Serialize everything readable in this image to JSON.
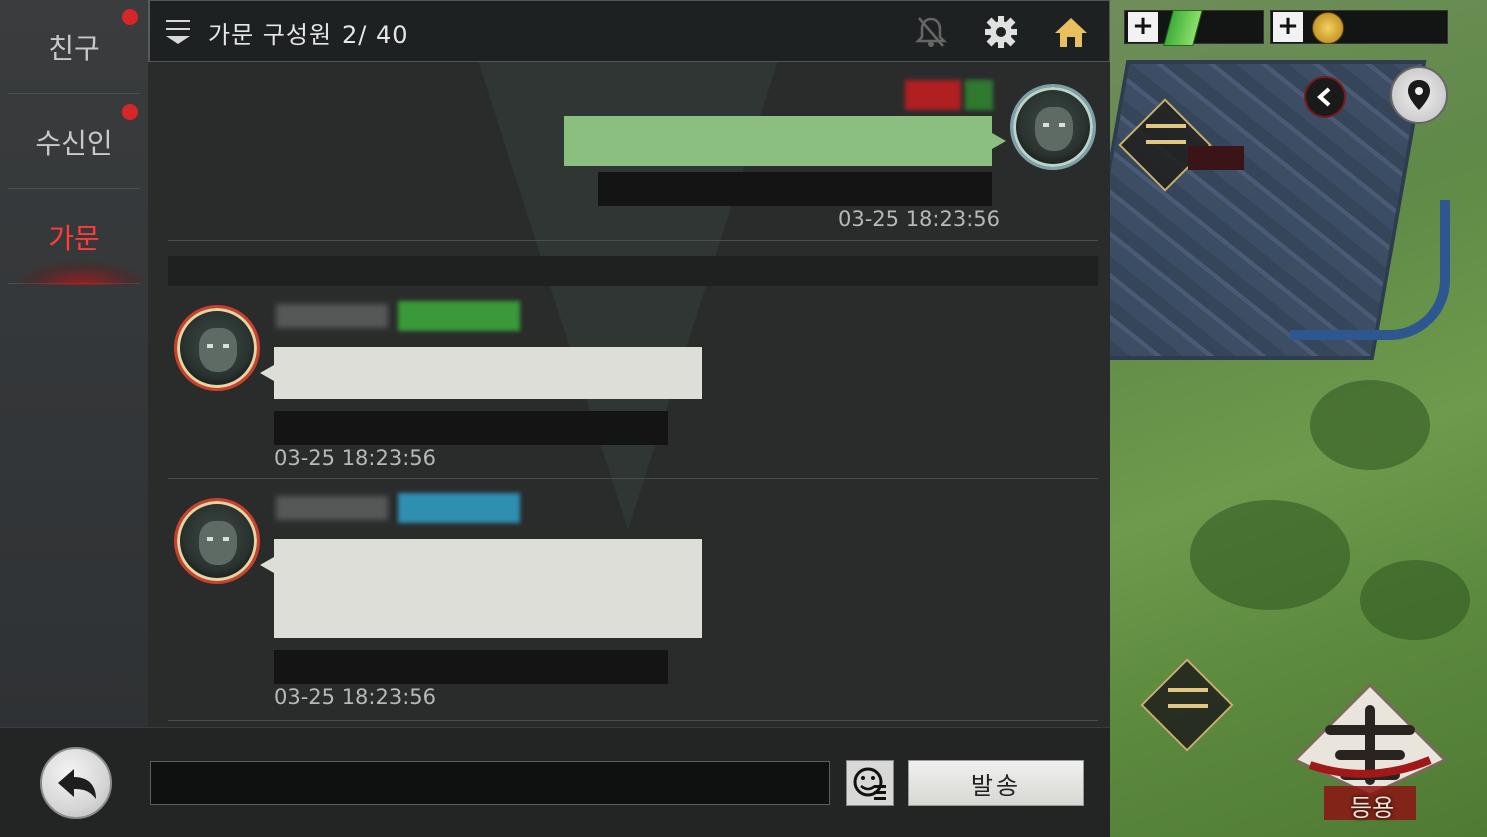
{
  "sidebar": {
    "tabs": [
      {
        "label": "친구",
        "active": false,
        "has_notification": true
      },
      {
        "label": "수신인",
        "active": false,
        "has_notification": true
      },
      {
        "label": "가문",
        "active": true,
        "has_notification": false
      }
    ]
  },
  "header": {
    "title": "가문 구성원",
    "member_count": "2/ 40",
    "icons": [
      "menu-icon",
      "bell-muted-icon",
      "gear-icon",
      "home-icon"
    ]
  },
  "messages": [
    {
      "sender": "self",
      "timestamp": "03-25 18:23:56",
      "bubble_color": "#8bbf7f"
    },
    {
      "sender": "other",
      "timestamp": "03-25 18:23:56",
      "tag_color": "#3a9a3a",
      "bubble_color": "#deded9"
    },
    {
      "sender": "other",
      "timestamp": "03-25 18:23:56",
      "tag_color": "#2f8fb0",
      "bubble_color": "#deded9"
    }
  ],
  "input": {
    "placeholder": "",
    "send_label": "발송"
  },
  "map": {
    "recruit_label": "등용",
    "icons": [
      "jade-icon",
      "gold-coin-icon",
      "back-arrow-icon",
      "location-pin-icon",
      "fortress-icon",
      "recruit-icon"
    ]
  },
  "colors": {
    "active_tab": "#ff3b3b",
    "notification": "#d6262a",
    "self_bubble": "#8bbf7f",
    "other_bubble": "#deded9"
  }
}
